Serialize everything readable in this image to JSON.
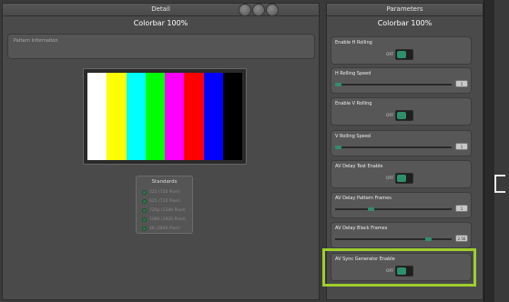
{
  "left": {
    "title": "Detail",
    "subtitle": "Colorbar 100%",
    "pattern_info_label": "Pattern Information"
  },
  "bars": [
    "#ffffff",
    "#ffff00",
    "#00ffff",
    "#00ff00",
    "#ff00ff",
    "#ff0000",
    "#0000ff",
    "#000000"
  ],
  "standards": {
    "title": "Standards",
    "items": [
      "525 (720 Pixel)",
      "625 (720 Pixel)",
      "720p (1280 Pixel)",
      "1080 (1920 Pixel)",
      "4K (3840 Pixel)"
    ]
  },
  "right": {
    "title": "Parameters",
    "subtitle": "Colorbar 100%",
    "params": [
      {
        "label": "Enable H Rolling",
        "off": "OFF"
      },
      {
        "label": "H Rolling Speed",
        "step": "1"
      },
      {
        "label": "Enable V Rolling",
        "off": "OFF"
      },
      {
        "label": "V Rolling Speed",
        "step": "1"
      },
      {
        "label": "AV Delay Test Enable",
        "off": "OFF"
      },
      {
        "label": "AV Delay Pattern Frames",
        "step": "1"
      },
      {
        "label": "AV Delay Black Frames",
        "step": "2.56"
      },
      {
        "label": "AV Sync Generator Enable",
        "off": "OFF"
      }
    ]
  },
  "accent": "#2f8f6a",
  "highlight_color": "#9ece2c"
}
